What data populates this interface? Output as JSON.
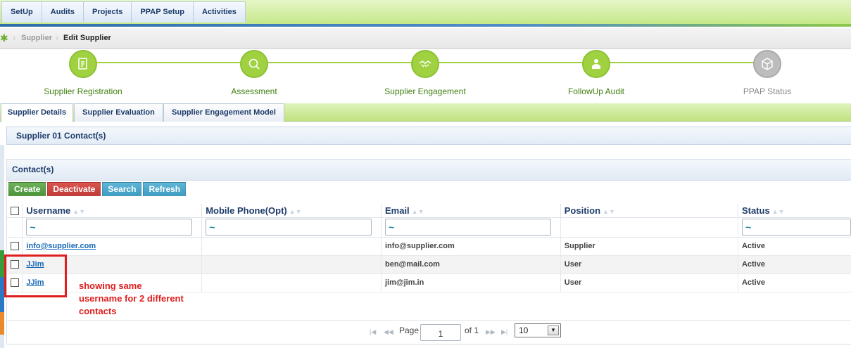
{
  "menu": [
    "SetUp",
    "Audits",
    "Projects",
    "PPAP Setup",
    "Activities"
  ],
  "breadcrumb": {
    "parent": "Supplier",
    "current": "Edit Supplier"
  },
  "steps": [
    {
      "label": "Supplier Registration",
      "icon": "registration-icon",
      "state": "done"
    },
    {
      "label": "Assessment",
      "icon": "assessment-icon",
      "state": "done"
    },
    {
      "label": "Supplier Engagement",
      "icon": "handshake-icon",
      "state": "done"
    },
    {
      "label": "FollowUp Audit",
      "icon": "audit-icon",
      "state": "done"
    },
    {
      "label": "PPAP Status",
      "icon": "cube-icon",
      "state": "pending"
    }
  ],
  "tabs": [
    "Supplier Details",
    "Supplier Evaluation",
    "Supplier Engagement Model"
  ],
  "section": {
    "title": "Supplier 01 Contact(s)"
  },
  "contacts": {
    "title": "Contact(s)",
    "buttons": {
      "create": "Create",
      "deactivate": "Deactivate",
      "search": "Search",
      "refresh": "Refresh"
    },
    "columns": [
      "Username",
      "Mobile Phone(Opt)",
      "Email",
      "Position",
      "Status"
    ],
    "filters": {
      "username": "~",
      "mobile": "~",
      "email": "~",
      "status": "~"
    },
    "rows": [
      {
        "username": "info@supplier.com",
        "mobile": "",
        "email": "info@supplier.com",
        "position": "Supplier",
        "status": "Active"
      },
      {
        "username": "JJim",
        "mobile": "",
        "email": "ben@mail.com",
        "position": "User",
        "status": "Active"
      },
      {
        "username": "JJim",
        "mobile": "",
        "email": "jim@jim.in",
        "position": "User",
        "status": "Active"
      }
    ]
  },
  "pager": {
    "page_label": "Page",
    "page": "1",
    "of_label": "of 1",
    "page_size": "10"
  },
  "annotation": {
    "text": "showing same username for 2 different contacts"
  },
  "colors": {
    "accent_green": "#9fd141",
    "annotation_red": "#e01e1e",
    "header_blue": "#1d3c6a"
  }
}
